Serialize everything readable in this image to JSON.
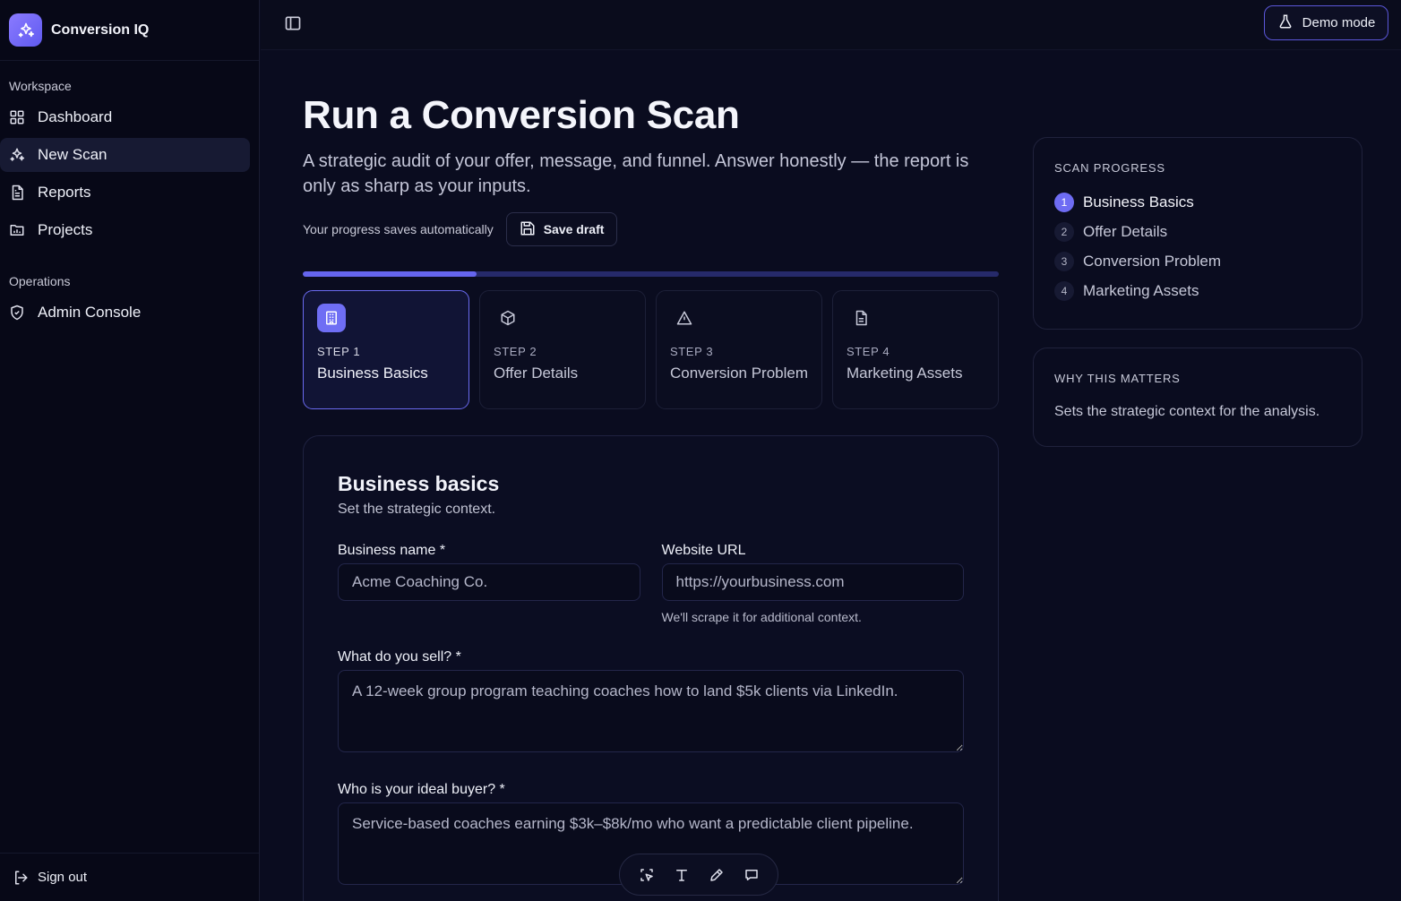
{
  "app": {
    "name": "Conversion IQ"
  },
  "sidebar": {
    "workspace_label": "Workspace",
    "items": [
      {
        "label": "Dashboard",
        "icon": "grid-icon"
      },
      {
        "label": "New Scan",
        "icon": "sparkles-icon",
        "active": true
      },
      {
        "label": "Reports",
        "icon": "document-icon"
      },
      {
        "label": "Projects",
        "icon": "folder-chart-icon"
      }
    ],
    "operations_label": "Operations",
    "ops_items": [
      {
        "label": "Admin Console",
        "icon": "shield-icon"
      }
    ],
    "sign_out": "Sign out"
  },
  "topbar": {
    "demo_label": "Demo mode"
  },
  "main": {
    "title": "Run a Conversion Scan",
    "subtitle": "A strategic audit of your offer, message, and funnel. Answer honestly — the report is only as sharp as your inputs.",
    "save_note": "Your progress saves automatically",
    "save_button": "Save draft",
    "progress_fraction": 0.25,
    "steps": [
      {
        "num": "STEP 1",
        "title": "Business Basics",
        "icon": "building-icon",
        "active": true
      },
      {
        "num": "STEP 2",
        "title": "Offer Details",
        "icon": "box-icon"
      },
      {
        "num": "STEP 3",
        "title": "Conversion Problem",
        "icon": "warning-icon"
      },
      {
        "num": "STEP 4",
        "title": "Marketing Assets",
        "icon": "file-icon"
      }
    ],
    "form": {
      "title": "Business basics",
      "subtitle": "Set the strategic context.",
      "business_name_label": "Business name *",
      "business_name_placeholder": "Acme Coaching Co.",
      "website_label": "Website URL",
      "website_placeholder": "https://yourbusiness.com",
      "website_hint": "We'll scrape it for additional context.",
      "sell_label": "What do you sell? *",
      "sell_placeholder": "A 12-week group program teaching coaches how to land $5k clients via LinkedIn.",
      "buyer_label": "Who is your ideal buyer? *",
      "buyer_placeholder": "Service-based coaches earning $3k–$8k/mo who want a predictable client pipeline."
    }
  },
  "right": {
    "progress_label": "SCAN PROGRESS",
    "progress_items": [
      {
        "n": "1",
        "label": "Business Basics",
        "active": true
      },
      {
        "n": "2",
        "label": "Offer Details"
      },
      {
        "n": "3",
        "label": "Conversion Problem"
      },
      {
        "n": "4",
        "label": "Marketing Assets"
      }
    ],
    "why_label": "WHY THIS MATTERS",
    "why_text": "Sets the strategic context for the analysis."
  },
  "toolbar": {
    "tools": [
      "select-icon",
      "text-icon",
      "pen-icon",
      "comment-icon"
    ]
  }
}
